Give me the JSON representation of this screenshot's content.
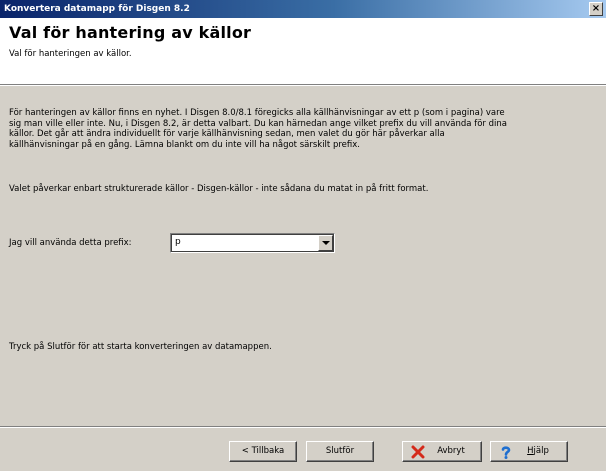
{
  "window": {
    "title": "Konvertera datamapp för Disgen 8.2",
    "close_symbol": "×"
  },
  "header": {
    "title": "Val för hantering av källor",
    "subtitle": "Val för hanteringen av källor."
  },
  "content": {
    "paragraph1": "För hanteringen av källor finns en nyhet. I Disgen 8.0/8.1 föregicks alla källhänvisningar av ett p (som i pagina) vare sig man ville eller inte. Nu, i Disgen 8.2, är detta valbart. Du kan härnedan ange vilket prefix du vill använda för dina källor. Det går att ändra individuellt för varje källhänvisning sedan, men valet du gör här påverkar alla källhänvisningar på en gång. Lämna blankt om du inte vill ha något särskilt prefix.",
    "paragraph2": "Valet påverkar enbart strukturerade källor - Disgen-källor - inte sådana du matat in på fritt format.",
    "prefix_label": "Jag vill använda detta prefix:",
    "prefix_value": "p",
    "paragraph3": "Tryck på Slutför för att starta konverteringen av datamappen."
  },
  "buttons": {
    "back": "< Tillbaka",
    "finish": "Slutför",
    "cancel": "Avbryt",
    "help_prefix": "",
    "help_mnemonic": "H",
    "help_rest": "jälp"
  },
  "icons": {
    "close": "close-icon",
    "dropdown": "chevron-down-icon",
    "cancel": "red-x-icon",
    "help": "question-mark-icon"
  },
  "colors": {
    "titlebar_start": "#0a246a",
    "titlebar_end": "#a6caf0",
    "window_bg": "#d4d0c8",
    "cancel_icon": "#d42a1a",
    "help_icon": "#1f6fd0"
  }
}
